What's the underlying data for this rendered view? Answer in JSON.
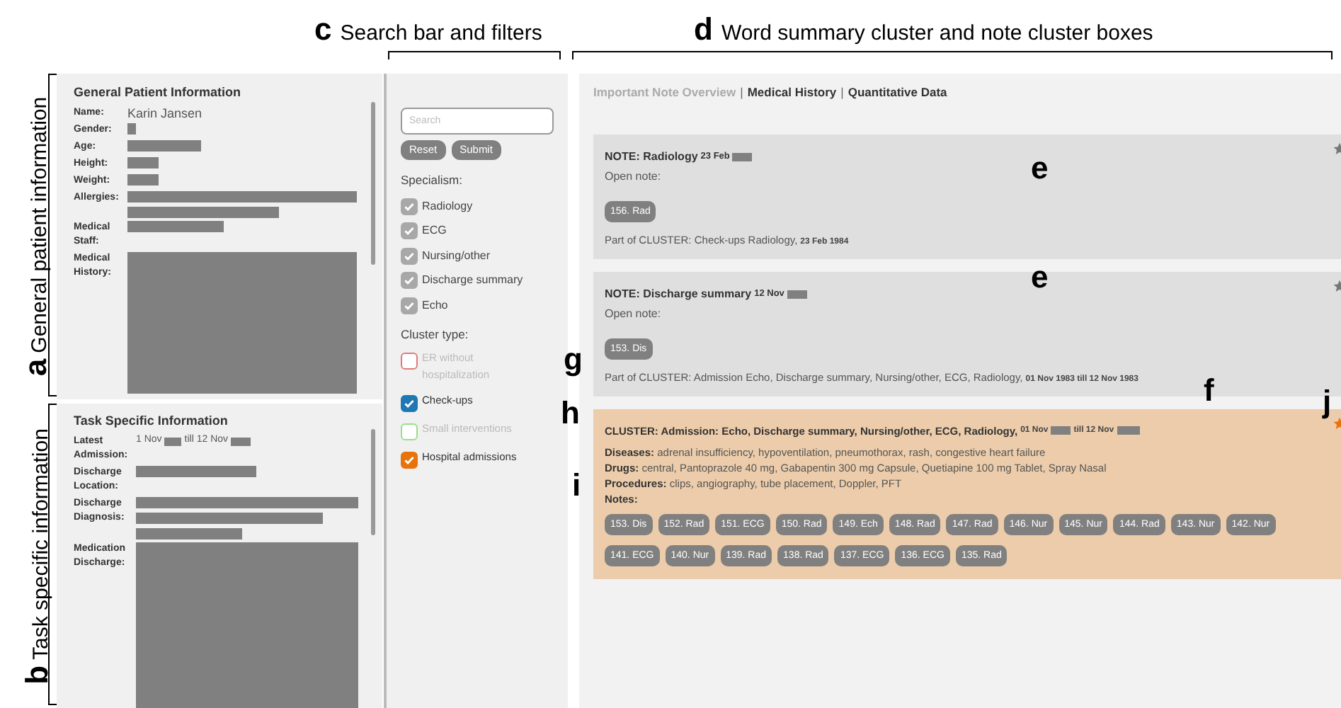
{
  "callouts": {
    "top": [
      {
        "letter": "c",
        "label": "Search bar and filters"
      },
      {
        "letter": "d",
        "label": "Word summary cluster and note cluster boxes"
      }
    ],
    "side": [
      {
        "letter": "a",
        "label": "General patient information"
      },
      {
        "letter": "b",
        "label": "Task specific information"
      }
    ],
    "marks": [
      "e",
      "e",
      "f",
      "g",
      "h",
      "i",
      "j"
    ]
  },
  "general": {
    "title": "General Patient Information",
    "fields": [
      {
        "label": "Name:",
        "value": "Karin Jansen"
      },
      {
        "label": "Gender:"
      },
      {
        "label": "Age:"
      },
      {
        "label": "Height:"
      },
      {
        "label": "Weight:"
      },
      {
        "label": "Allergies:"
      },
      {
        "label": "Medical Staff:"
      },
      {
        "label": "Medical History:"
      }
    ]
  },
  "task": {
    "title": "Task Specific Information",
    "fields": [
      {
        "label": "Latest Admission:",
        "from": "1 Nov",
        "till": "till 12 Nov"
      },
      {
        "label": "Discharge Location:"
      },
      {
        "label": "Discharge Diagnosis:"
      },
      {
        "label": "Medication Discharge:"
      }
    ]
  },
  "filters": {
    "search": {
      "placeholder": "Search"
    },
    "buttons": [
      "Reset",
      "Submit"
    ],
    "specialism": {
      "title": "Specialism:",
      "items": [
        {
          "label": "Radiology",
          "checked": true
        },
        {
          "label": "ECG",
          "checked": true
        },
        {
          "label": "Nursing/other",
          "checked": true
        },
        {
          "label": "Discharge summary",
          "checked": true
        },
        {
          "label": "Echo",
          "checked": true
        }
      ]
    },
    "cluster_type": {
      "title": "Cluster type:",
      "items": [
        {
          "label": "ER without hospitalization",
          "checked": false,
          "color": "#e07b7b"
        },
        {
          "label": "Check-ups",
          "checked": true,
          "color": "#1f77b4"
        },
        {
          "label": "Small interventions",
          "checked": false,
          "color": "#98df8a"
        },
        {
          "label": "Hospital admissions",
          "checked": true,
          "color": "#e8730c"
        }
      ]
    }
  },
  "tabs": [
    {
      "label": "Important Note Overview",
      "selected": true
    },
    {
      "label": "Medical History",
      "selected": false
    },
    {
      "label": "Quantitative Data",
      "selected": false
    }
  ],
  "tab_separators": [
    "|",
    "|"
  ],
  "notes": [
    {
      "title": "NOTE: Radiology",
      "date": "23 Feb",
      "open_label": "Open note:",
      "chip": "156. Rad",
      "cluster": "Part of CLUSTER: Check-ups Radiology,",
      "cluster_date": "23 Feb 1984",
      "starred": false
    },
    {
      "title": "NOTE: Discharge summary",
      "date": "12 Nov",
      "open_label": "Open note:",
      "chip": "153. Dis",
      "cluster": "Part of CLUSTER: Admission Echo, Discharge summary, Nursing/other, ECG, Radiology,",
      "cluster_date": "01 Nov 1983 till 12 Nov 1983",
      "starred": false
    }
  ],
  "cluster": {
    "title": "CLUSTER: Admission: Echo, Discharge summary, Nursing/other, ECG, Radiology,",
    "from": "01 Nov",
    "till": "till 12 Nov",
    "starred": true,
    "lines": [
      {
        "label": "Diseases:",
        "text": "adrenal insufficiency, hypoventilation, pneumothorax, rash, congestive heart failure"
      },
      {
        "label": "Drugs:",
        "text": "central, Pantoprazole 40 mg, Gabapentin 300 mg Capsule, Quetiapine 100 mg Tablet, Spray Nasal"
      },
      {
        "label": "Procedures:",
        "text": "clips, angiography, tube placement, Doppler, PFT"
      }
    ],
    "notes_label": "Notes:",
    "chips": [
      "153. Dis",
      "152. Rad",
      "151. ECG",
      "150. Rad",
      "149. Ech",
      "148. Rad",
      "147. Rad",
      "146. Nur",
      "145. Nur",
      "144. Rad",
      "143. Nur",
      "142. Nur",
      "141. ECG",
      "140. Nur",
      "139. Rad",
      "138. Rad",
      "137. ECG",
      "136. ECG",
      "135. Rad"
    ]
  }
}
